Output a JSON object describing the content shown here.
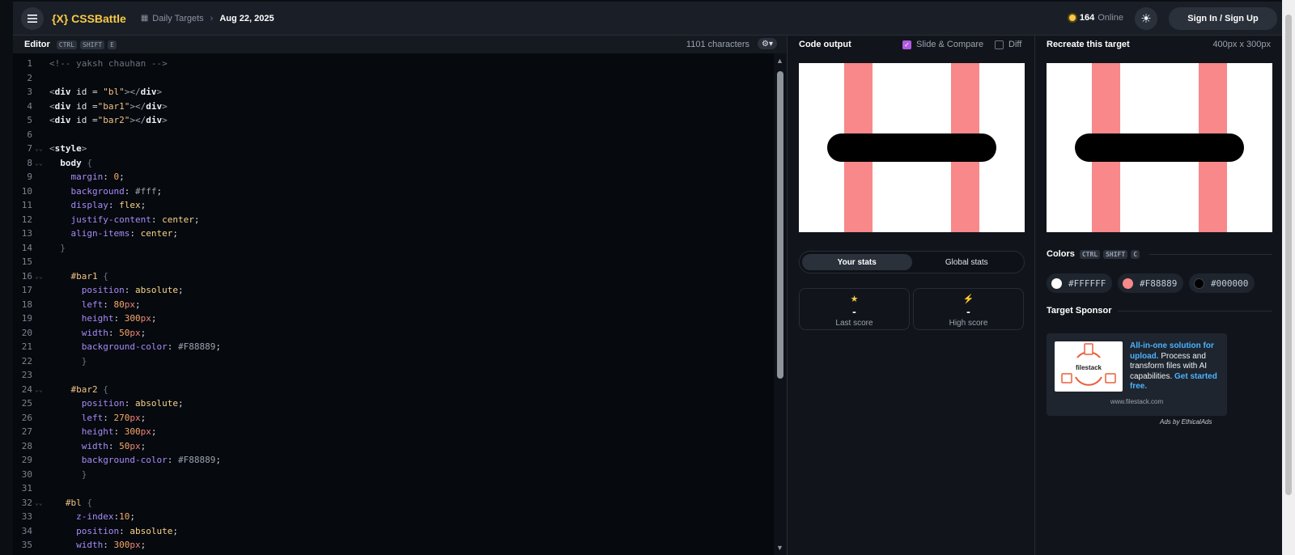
{
  "header": {
    "brand": "{X} CSSBattle",
    "crumb_section": "Daily Targets",
    "crumb_date": "Aug 22, 2025",
    "online_count": "164",
    "online_label": "Online",
    "signin_label": "Sign In / Sign Up"
  },
  "editor": {
    "title": "Editor",
    "shortcut": [
      "CTRL",
      "SHIFT",
      "E"
    ],
    "char_count": "1101 characters",
    "lines": [
      "1",
      "2",
      "3",
      "4",
      "5",
      "6",
      "7",
      "8",
      "9",
      "10",
      "11",
      "12",
      "13",
      "14",
      "15",
      "16",
      "17",
      "18",
      "19",
      "20",
      "21",
      "22",
      "23",
      "24",
      "25",
      "26",
      "27",
      "28",
      "29",
      "30",
      "31",
      "32",
      "33",
      "34"
    ]
  },
  "output": {
    "title": "Code output",
    "slide_compare_label": "Slide & Compare",
    "slide_compare_checked": true,
    "diff_label": "Diff",
    "diff_checked": false,
    "tab_your_stats": "Your stats",
    "tab_global_stats": "Global stats",
    "last_score_value": "-",
    "last_score_label": "Last score",
    "high_score_value": "-",
    "high_score_label": "High score"
  },
  "target": {
    "title": "Recreate this target",
    "size": "400px x 300px",
    "colors_title": "Colors",
    "colors_shortcut": [
      "CTRL",
      "SHIFT",
      "C"
    ],
    "colors": [
      {
        "hex": "#FFFFFF",
        "label": "#FFFFFF"
      },
      {
        "hex": "#F88889",
        "label": "#F88889"
      },
      {
        "hex": "#000000",
        "label": "#000000"
      }
    ],
    "sponsor_title": "Target Sponsor",
    "sponsor_logo_text": "filestack",
    "sponsor_headline": "All-in-one solution for upload.",
    "sponsor_body": " Process and transform files with AI capabilities. ",
    "sponsor_cta": "Get started free.",
    "sponsor_url": "www.filestack.com",
    "ads_by": "Ads by EthicalAds"
  },
  "icons": [
    "menu-icon",
    "calendar-icon",
    "chevron-right-icon",
    "sun-icon",
    "gear-icon",
    "star-icon",
    "bolt-icon",
    "check-icon"
  ],
  "colors_ui": {
    "accent": "#f7c948",
    "bar": "#F88889",
    "pill": "#000000",
    "check": "#b15be0"
  }
}
